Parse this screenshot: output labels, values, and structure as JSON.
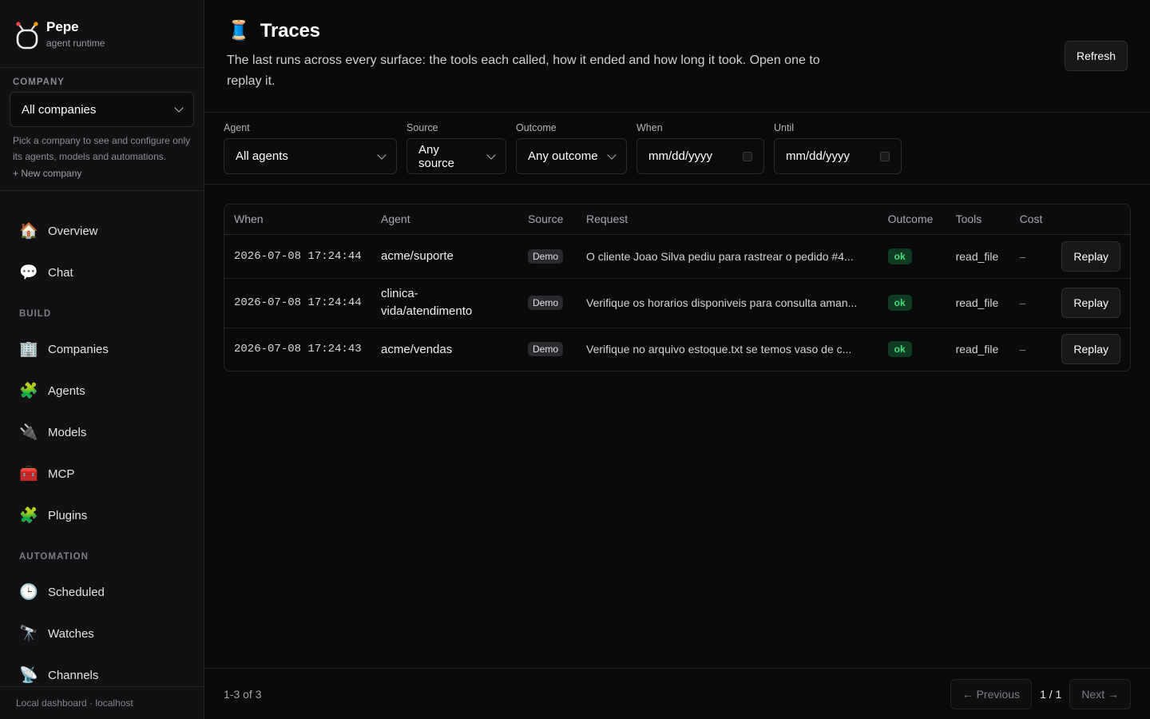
{
  "brand": {
    "name": "Pepe",
    "subtitle": "agent runtime"
  },
  "company": {
    "section_label": "COMPANY",
    "selected": "All companies",
    "help": "Pick a company to see and configure only its agents, models and automations.",
    "new_company": "+ New company"
  },
  "nav": {
    "top": [
      {
        "label": "Overview",
        "icon": "🏠"
      },
      {
        "label": "Chat",
        "icon": "💬"
      }
    ],
    "build_label": "BUILD",
    "build": [
      {
        "label": "Companies",
        "icon": "🏢"
      },
      {
        "label": "Agents",
        "icon": "🧩"
      },
      {
        "label": "Models",
        "icon": "🔌"
      },
      {
        "label": "MCP",
        "icon": "🧰"
      },
      {
        "label": "Plugins",
        "icon": "🧩"
      }
    ],
    "automation_label": "AUTOMATION",
    "automation": [
      {
        "label": "Scheduled",
        "icon": "🕒"
      },
      {
        "label": "Watches",
        "icon": "🔭"
      },
      {
        "label": "Channels",
        "icon": "📡"
      }
    ]
  },
  "footer": "Local dashboard · localhost",
  "page": {
    "icon": "🧵",
    "title": "Traces",
    "subtitle": "The last runs across every surface: the tools each called, how it ended and how long it took. Open one to replay it.",
    "refresh_label": "Refresh"
  },
  "filters": {
    "agent": {
      "label": "Agent",
      "value": "All agents"
    },
    "source": {
      "label": "Source",
      "value": "Any source"
    },
    "outcome": {
      "label": "Outcome",
      "value": "Any outcome"
    },
    "when": {
      "label": "When",
      "value": "mm/dd/yyyy"
    },
    "until": {
      "label": "Until",
      "value": "mm/dd/yyyy"
    }
  },
  "table": {
    "headers": {
      "when": "When",
      "agent": "Agent",
      "source": "Source",
      "request": "Request",
      "outcome": "Outcome",
      "tools": "Tools",
      "cost": "Cost"
    },
    "rows": [
      {
        "when": "2026-07-08 17:24:44",
        "agent": "acme/suporte",
        "source": "Demo",
        "request": "O cliente Joao Silva pediu para rastrear o pedido #4...",
        "outcome": "ok",
        "tools": "read_file",
        "cost": "–",
        "action": "Replay"
      },
      {
        "when": "2026-07-08 17:24:44",
        "agent": "clinica-vida/atendimento",
        "source": "Demo",
        "request": "Verifique os horarios disponiveis para consulta aman...",
        "outcome": "ok",
        "tools": "read_file",
        "cost": "–",
        "action": "Replay"
      },
      {
        "when": "2026-07-08 17:24:43",
        "agent": "acme/vendas",
        "source": "Demo",
        "request": "Verifique no arquivo estoque.txt se temos vaso de c...",
        "outcome": "ok",
        "tools": "read_file",
        "cost": "–",
        "action": "Replay"
      }
    ]
  },
  "pager": {
    "count": "1-3 of 3",
    "previous": "← Previous",
    "page": "1 / 1",
    "next": "Next →"
  }
}
